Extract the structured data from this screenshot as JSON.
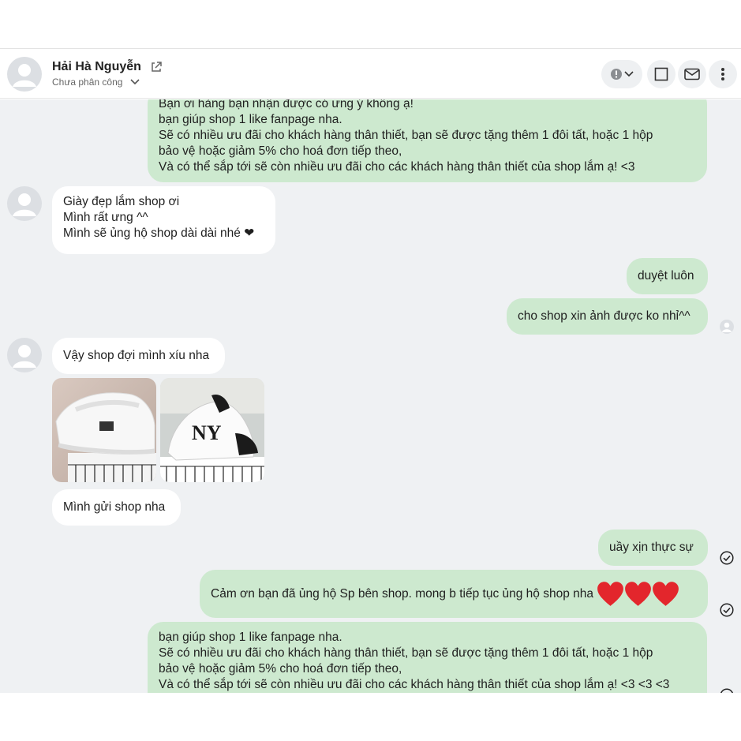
{
  "header": {
    "name": "Hải Hà Nguyễn",
    "assign_label": "Chưa phân công"
  },
  "icons": {
    "external": "external-link-icon",
    "chevron": "chevron-down-icon",
    "info": "info-icon",
    "square": "square-icon",
    "mail": "mail-icon",
    "more": "more-vertical-icon",
    "read": "check-circle-icon",
    "heart": "heart-icon"
  },
  "colors": {
    "incoming_bubble": "#ffffff",
    "outgoing_bubble": "#cde9cf",
    "chat_bg": "#eff1f3",
    "heart": "#e3262c"
  },
  "messages": {
    "m1": "Bạn ơi hàng bạn nhận được có ưng ý không ạ!\nbạn giúp shop 1 like fanpage nha.\nSẽ có nhiều ưu đãi cho khách hàng thân thiết, bạn sẽ được tặng thêm 1 đôi tất, hoặc 1 hộp\nbảo vệ hoặc giảm 5% cho hoá đơn tiếp theo,\nVà có thể sắp tới sẽ còn nhiều ưu đãi cho các khách hàng thân thiết của shop lắm ạ! <3",
    "m2": "Giày đẹp lắm shop ơi\nMình rất ưng ^^\nMình sẽ ủng hộ shop dài dài nhé ❤",
    "m3": "duyệt luôn",
    "m4": "cho shop xin ảnh được ko nhỉ^^",
    "m5": "Vậy shop đợi mình xíu nha",
    "m6": "Mình gửi shop nha",
    "m7": "uầy xịn thực sự",
    "m8": "Cảm ơn bạn đã ủng hộ Sp bên shop. mong b tiếp tục ủng hộ shop nha",
    "m9": "bạn giúp shop 1 like fanpage nha.\nSẽ có nhiều ưu đãi cho khách hàng thân thiết, bạn sẽ được tặng thêm 1 đôi tất, hoặc 1 hộp\nbảo vệ hoặc giảm 5% cho hoá đơn tiếp theo,\nVà có thể sắp tới sẽ còn nhiều ưu đãi cho các khách hàng thân thiết của shop lắm ạ! <3 <3 <3"
  }
}
